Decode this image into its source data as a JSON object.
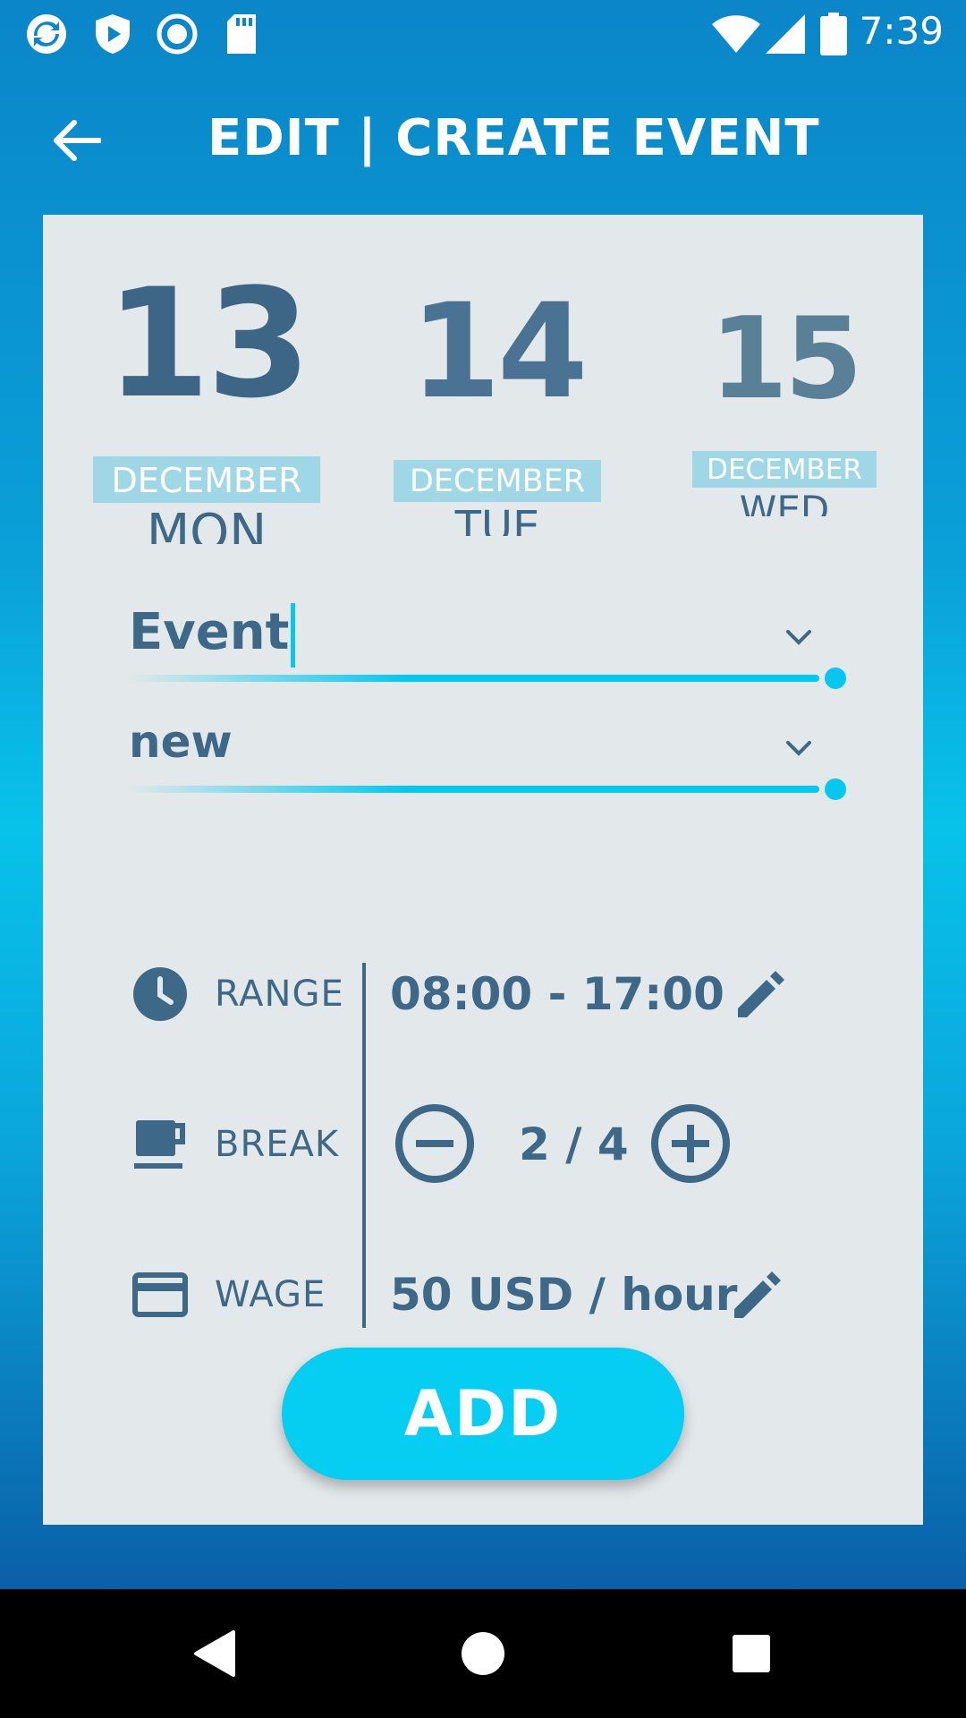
{
  "status_bar": {
    "time": "7:39",
    "left_icons": [
      "refresh-app-icon",
      "shield-play-icon",
      "circle-record-icon",
      "sd-card-icon"
    ],
    "right_icons": [
      "wifi-icon",
      "signal-icon",
      "battery-icon"
    ]
  },
  "app_bar": {
    "title": "EDIT | CREATE EVENT",
    "back_icon": "arrow-back-icon"
  },
  "day_picker": [
    {
      "number": "13",
      "month": "DECEMBER",
      "weekday": "MON"
    },
    {
      "number": "14",
      "month": "DECEMBER",
      "weekday": "TUE"
    },
    {
      "number": "15",
      "month": "DECEMBER",
      "weekday": "WED"
    }
  ],
  "form": {
    "event_name": "Event",
    "event_type": "new"
  },
  "details": {
    "range": {
      "label": "RANGE",
      "value": "08:00 - 17:00",
      "icon": "clock-icon"
    },
    "break": {
      "label": "BREAK",
      "value": "2 / 4",
      "icon": "coffee-cup-icon"
    },
    "wage": {
      "label": "WAGE",
      "amount": "50",
      "currency": "USD",
      "unit": "/ hour",
      "icon": "credit-card-icon"
    }
  },
  "add_button": "ADD",
  "colors": {
    "primary_text": "#3e6887",
    "accent": "#06c7f0",
    "card_bg": "#e3e8ea",
    "month_badge": "#9fd7e6"
  }
}
